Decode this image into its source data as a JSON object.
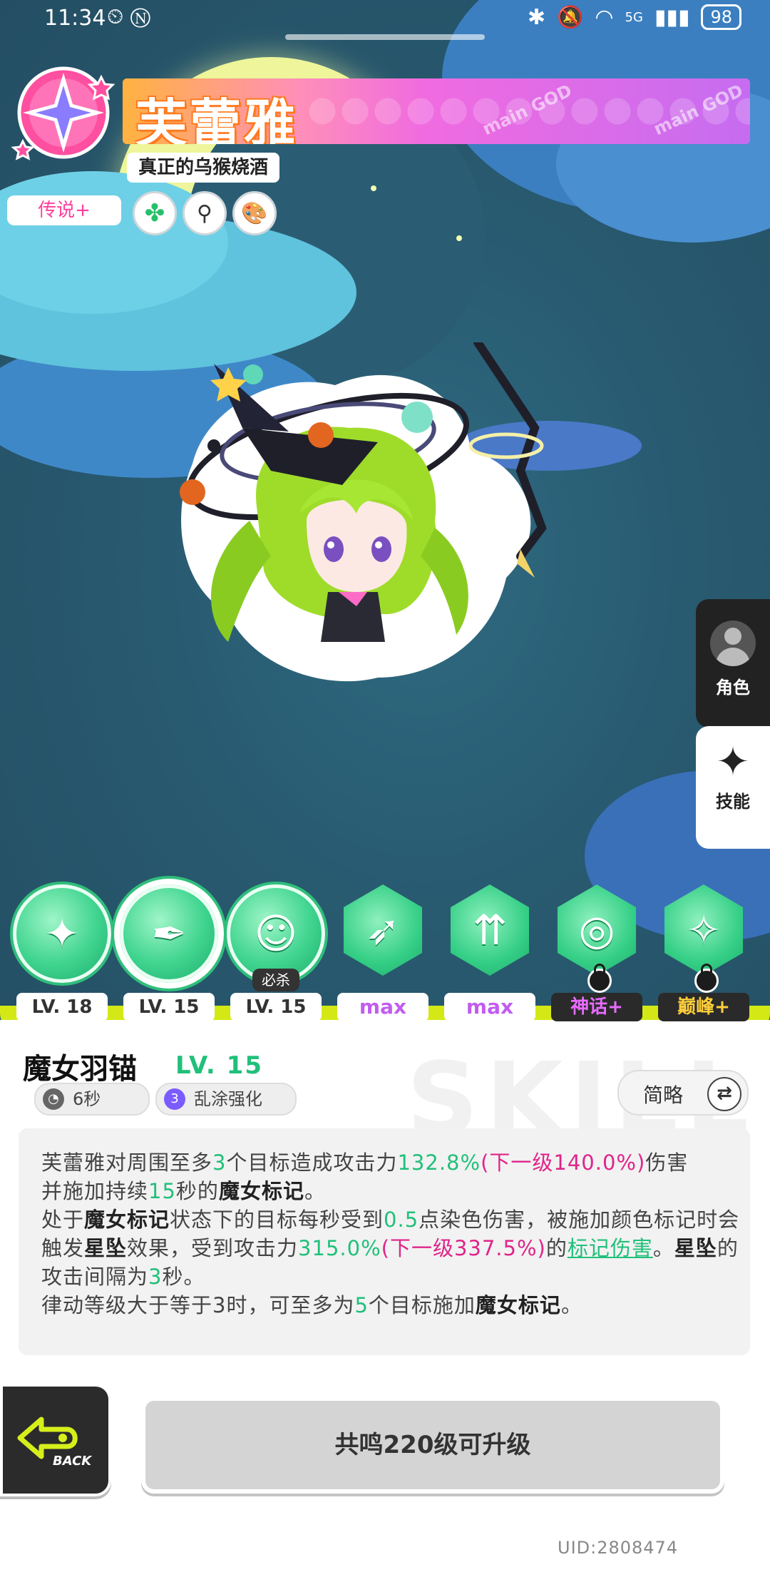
{
  "status_bar": {
    "time": "11:34",
    "network": "5G",
    "battery": "98"
  },
  "header": {
    "character_name": "芙蕾雅",
    "title": "真正的乌猴烧酒",
    "rarity": "传说+",
    "banner_brand": "main GOD"
  },
  "side_tabs": {
    "role": "角色",
    "skill": "技能"
  },
  "skills": [
    {
      "level": "LV. 18",
      "shape": "circle",
      "selected": false
    },
    {
      "level": "LV. 15",
      "shape": "circle",
      "selected": true
    },
    {
      "level": "LV. 15",
      "shape": "circle",
      "selected": false,
      "tag": "必杀"
    },
    {
      "level": "max",
      "shape": "hex",
      "selected": false
    },
    {
      "level": "max",
      "shape": "hex",
      "selected": false
    },
    {
      "level": "神话+",
      "shape": "hex",
      "selected": false,
      "locked": true
    },
    {
      "level": "巅峰+",
      "shape": "hex",
      "selected": false,
      "locked": true
    }
  ],
  "detail": {
    "skill_name": "魔女羽锚",
    "skill_level": "LV. 15",
    "cooldown": "6秒",
    "enhance_count": "3",
    "enhance_label": "乱涂强化",
    "view_mode": "简略",
    "toggle_symbol": "⇄",
    "description": {
      "p1": [
        "芙蕾雅对周围至多",
        "3",
        "个目标造成攻击力",
        "132.8%",
        "(下一级140.0%)",
        "伤害"
      ],
      "p2": [
        "并施加持续",
        "15",
        "秒的",
        "魔女标记",
        "。"
      ],
      "p3": [
        "处于",
        "魔女标记",
        "状态下的目标每秒受到",
        "0.5",
        "点染色伤害，被施加颜色标记时会触发",
        "星坠",
        "效果，受到攻击力",
        "315.0%",
        "(下一级337.5%)",
        "的",
        "标记伤害",
        "。",
        "星坠",
        "的攻击间隔为",
        "3",
        "秒。"
      ],
      "p4": [
        "律动等级大于等于3时，可至多为",
        "5",
        "个目标施加",
        "魔女标记",
        "。"
      ]
    },
    "watermark": "SKILL"
  },
  "footer": {
    "back_label": "BACK",
    "upgrade_label": "共鸣220级可升级",
    "uid": "UID:2808474"
  },
  "colors": {
    "accent_green": "#21c07a",
    "accent_pink": "#e0248a",
    "slime": "#d4e816"
  }
}
